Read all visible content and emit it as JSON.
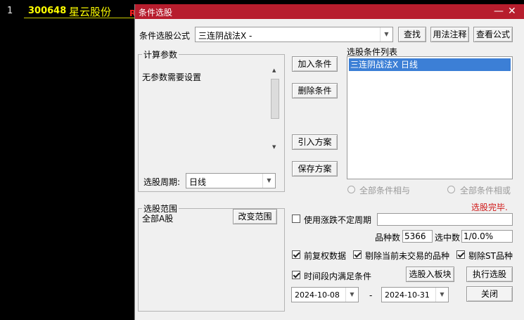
{
  "background": {
    "row_number": "1",
    "stock_code": "300648",
    "stock_name": "星云股份",
    "flag": "R"
  },
  "dialog": {
    "title": "条件选股",
    "minimize_icon": "minus-icon",
    "close_icon": "close-icon",
    "formula_label": "条件选股公式",
    "formula_value": "三连阴战法X  -",
    "find_button": "查找",
    "usage_button": "用法注释",
    "view_formula_button": "查看公式",
    "params_group": "计算参数",
    "params_text": "无参数需要设置",
    "period_label": "选股周期:",
    "period_value": "日线",
    "add_condition": "加入条件",
    "delete_condition": "删除条件",
    "import_plan": "引入方案",
    "save_plan": "保存方案",
    "conditions_list_label": "选股条件列表",
    "conditions": [
      "三连阴战法X  日线"
    ],
    "radio_and": "全部条件相与",
    "radio_or": "全部条件相或",
    "status": "选股完毕.",
    "range_group": "选股范围",
    "range_value": "全部A股",
    "change_range": "改变范围",
    "use_irregular_period": "使用涨跌不定周期",
    "count_label": "品种数",
    "count_value": "5366",
    "selected_label": "选中数",
    "selected_value": "1/0.0%",
    "forward_adjust": "前复权数据",
    "remove_untraded": "剔除当前未交易的品种",
    "remove_st": "剔除ST品种",
    "time_range": "时间段内满足条件",
    "to_sector": "选股入板块",
    "execute": "执行选股",
    "date_from": "2024-10-08",
    "date_sep": "-",
    "date_to": "2024-10-31",
    "close": "关闭"
  }
}
